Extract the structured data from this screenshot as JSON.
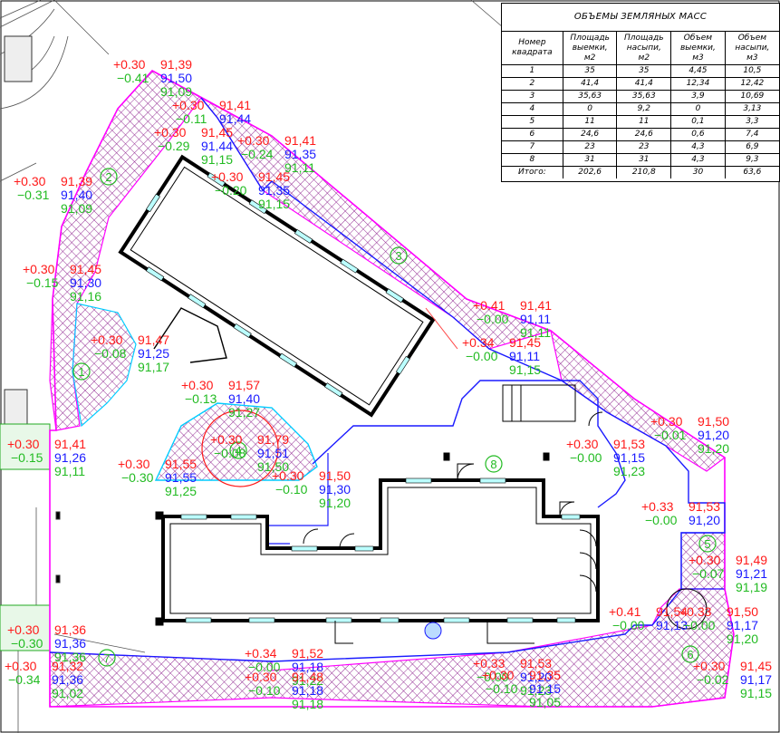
{
  "colors": {
    "red": "#ff1a1a",
    "blue": "#1a1aff",
    "green": "#22bb22",
    "magenta": "#ff00ff",
    "cyan": "#00ccff",
    "hatch": "#8a1a8a"
  },
  "table": {
    "title": "ОБЪЕМЫ ЗЕМЛЯНЫХ МАСС",
    "headers": [
      [
        "Номер",
        "квадрата"
      ],
      [
        "Площадь",
        "выемки,",
        "м2"
      ],
      [
        "Площадь",
        "насыпи,",
        "м2"
      ],
      [
        "Объем",
        "выемки,",
        "м3"
      ],
      [
        "Объем",
        "насыпи,",
        "м3"
      ]
    ],
    "rows": [
      [
        "1",
        "35",
        "35",
        "4,45",
        "10,5"
      ],
      [
        "2",
        "41,4",
        "41,4",
        "12,34",
        "12,42"
      ],
      [
        "3",
        "35,63",
        "35,63",
        "3,9",
        "10,69"
      ],
      [
        "4",
        "0",
        "9,2",
        "0",
        "3,13"
      ],
      [
        "5",
        "11",
        "11",
        "0,1",
        "3,3"
      ],
      [
        "6",
        "24,6",
        "24,6",
        "0,6",
        "7,4"
      ],
      [
        "7",
        "23",
        "23",
        "4,3",
        "6,9"
      ],
      [
        "8",
        "31",
        "31",
        "4,3",
        "9,3"
      ],
      [
        "Итого:",
        "202,6",
        "210,8",
        "30",
        "63,6"
      ]
    ]
  },
  "zones": [
    "1",
    "2",
    "3",
    "4",
    "5",
    "6",
    "7",
    "8"
  ],
  "marks": [
    {
      "w": "+0.30",
      "d": "91,39",
      "p": "91,50",
      "c": "-0.41",
      "e": "91,09"
    },
    {
      "w": "+0.30",
      "d": "91,41",
      "p": "91,44",
      "c": "-0.11",
      "e": ""
    },
    {
      "w": "+0.30",
      "d": "91,45",
      "p": "91,44",
      "c": "-0.29",
      "e": "91,15"
    },
    {
      "w": "+0.30",
      "d": "91,41",
      "p": "91,35",
      "c": "-0.24",
      "e": "91,11"
    },
    {
      "w": "+0.30",
      "d": "91,45",
      "p": "91,35",
      "c": "-0.20",
      "e": "91,15"
    },
    {
      "w": "+0.30",
      "d": "91,39",
      "p": "91,40",
      "c": "-0.31",
      "e": "91,09"
    },
    {
      "w": "+0.30",
      "d": "91,45",
      "p": "91,30",
      "c": "-0.15",
      "e": "91,16"
    },
    {
      "w": "+0.30",
      "d": "91,47",
      "p": "91,25",
      "c": "-0.08",
      "e": "91,17"
    },
    {
      "w": "+0.30",
      "d": "91,57",
      "p": "91,40",
      "c": "-0.13",
      "e": "91,27"
    },
    {
      "w": "+0.30",
      "d": "91,79",
      "p": "91,51",
      "c": "-0.08",
      "e": "91,50"
    },
    {
      "w": "+0.30",
      "d": "91,41",
      "p": "91,26",
      "c": "-0.15",
      "e": "91,11"
    },
    {
      "w": "+0.30",
      "d": "91,55",
      "p": "91,55",
      "c": "-0.30",
      "e": "91,25"
    },
    {
      "w": "+0.30",
      "d": "91,50",
      "p": "91,30",
      "c": "-0.10",
      "e": "91,20"
    },
    {
      "w": "+0.41",
      "d": "91,41",
      "p": "91,11",
      "c": "-0.00",
      "e": "91,11"
    },
    {
      "w": "+0.34",
      "d": "91,45",
      "p": "91,11",
      "c": "-0.00",
      "e": "91,15"
    },
    {
      "w": "+0.30",
      "d": "91,53",
      "p": "91,15",
      "c": "-0.00",
      "e": "91,23"
    },
    {
      "w": "+0.30",
      "d": "91,50",
      "p": "91,20",
      "c": "-0.01",
      "e": "91,20"
    },
    {
      "w": "+0.33",
      "d": "91,53",
      "p": "91,20",
      "c": "-0.00",
      "e": ""
    },
    {
      "w": "+0.30",
      "d": "91,49",
      "p": "91,21",
      "c": "-0.07",
      "e": "91,19"
    },
    {
      "w": "+0.41",
      "d": "91,54",
      "p": "91,13",
      "c": "-0.00",
      "e": ""
    },
    {
      "w": "+0.33",
      "d": "91,50",
      "p": "91,17",
      "c": "-0.00",
      "e": "91,20"
    },
    {
      "w": "+0.30",
      "d": "91,45",
      "p": "91,17",
      "c": "-0.02",
      "e": "91,15"
    },
    {
      "w": "+0.34",
      "d": "91,52",
      "p": "91,18",
      "c": "-0.00",
      "e": "91,22"
    },
    {
      "w": "+0.30",
      "d": "91,48",
      "p": "91,18",
      "c": "-0.10",
      "e": "91,18"
    },
    {
      "w": "+0.33",
      "d": "91,53",
      "p": "91,20",
      "c": "-0.00",
      "e": "91,23"
    },
    {
      "w": "+0.30",
      "d": "91,35",
      "p": "91,15",
      "c": "-0.10",
      "e": "91,05"
    },
    {
      "w": "+0.30",
      "d": "91,36",
      "p": "91,36",
      "c": "-0.30",
      "e": "91,36"
    },
    {
      "w": "+0.30",
      "d": "91,32",
      "p": "91,36",
      "c": "-0.34",
      "e": "91,02"
    }
  ]
}
